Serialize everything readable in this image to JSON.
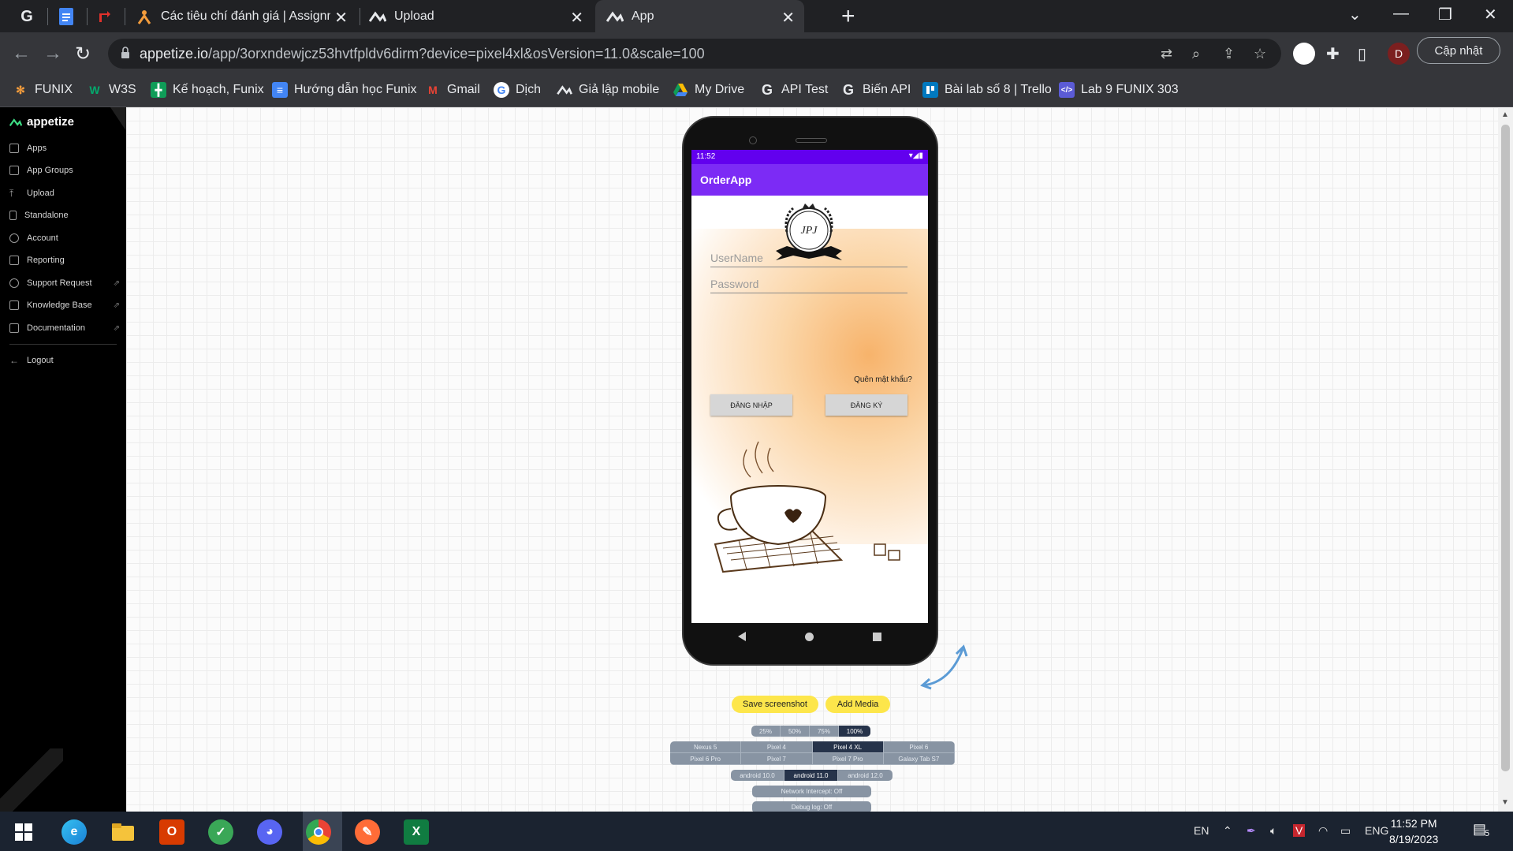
{
  "browser": {
    "tabs": [
      {
        "title": "Các tiêu chí đánh giá | Assignment",
        "active": false
      },
      {
        "title": "Upload",
        "active": false
      },
      {
        "title": "App",
        "active": true
      }
    ],
    "pinned_tabs": [
      "G",
      "docs",
      "red-arrow"
    ],
    "url_host": "appetize.io",
    "url_path": "/app/3orxndewjcz53hvtfpldv6dirm?device=pixel4xl&osVersion=11.0&scale=100",
    "update_label": "Cập nhật",
    "profile_initial": "D"
  },
  "bookmarks": [
    {
      "label": "FUNIX",
      "icon": "funix-icon",
      "color": "#f39c3c"
    },
    {
      "label": "W3S",
      "icon": "w3s-icon",
      "color": "#04aa6d"
    },
    {
      "label": "Kế hoạch, Funix",
      "icon": "sheets-icon",
      "color": "#0f9d58"
    },
    {
      "label": "Hướng dẫn học Funix",
      "icon": "docs-icon",
      "color": "#4285f4"
    },
    {
      "label": "Gmail",
      "icon": "gmail-icon",
      "color": "#ea4335"
    },
    {
      "label": "Dịch",
      "icon": "google-icon",
      "color": "#ffffff"
    },
    {
      "label": "Giả lập mobile",
      "icon": "appetize-icon",
      "color": "#ffffff"
    },
    {
      "label": "My Drive",
      "icon": "drive-icon",
      "color": "#fbbc04"
    },
    {
      "label": "API Test",
      "icon": "g-icon",
      "color": "#ffffff"
    },
    {
      "label": "Biến API",
      "icon": "g-icon",
      "color": "#ffffff"
    },
    {
      "label": "Bài lab số 8 | Trello",
      "icon": "trello-icon",
      "color": "#0079bf"
    },
    {
      "label": "Lab 9 FUNIX 303",
      "icon": "code-icon",
      "color": "#5b5bd6"
    }
  ],
  "sidebar": {
    "brand": "appetize",
    "items": [
      {
        "label": "Apps",
        "external": false
      },
      {
        "label": "App Groups",
        "external": false
      },
      {
        "label": "Upload",
        "external": false
      },
      {
        "label": "Standalone",
        "external": false
      },
      {
        "label": "Account",
        "external": false
      },
      {
        "label": "Reporting",
        "external": false
      },
      {
        "label": "Support Request",
        "external": true
      },
      {
        "label": "Knowledge Base",
        "external": true
      },
      {
        "label": "Documentation",
        "external": true
      }
    ],
    "logout": "Logout"
  },
  "phone": {
    "status_time": "11:52",
    "app_title": "OrderApp",
    "logo_text": "JPJ",
    "username_placeholder": "UserName",
    "password_placeholder": "Password",
    "forgot_label": "Quên mật khẩu?",
    "login_label": "ĐĂNG NHẬP",
    "register_label": "ĐĂNG KÝ"
  },
  "controls": {
    "save_screenshot": "Save screenshot",
    "add_media": "Add Media",
    "scales": [
      "25%",
      "50%",
      "75%",
      "100%"
    ],
    "scale_selected": "100%",
    "devices": [
      "Nexus 5",
      "Pixel 4",
      "Pixel 4 XL",
      "Pixel 6",
      "Pixel 6 Pro",
      "Pixel 7",
      "Pixel 7 Pro",
      "Galaxy Tab S7"
    ],
    "device_selected": "Pixel 4 XL",
    "os_versions": [
      "android 10.0",
      "android 11.0",
      "android 12.0"
    ],
    "os_selected": "android 11.0",
    "network_intercept": "Network Intercept: Off",
    "debug_log": "Debug log: Off"
  },
  "taskbar": {
    "lang": "EN",
    "ime": "ENG",
    "time": "11:52 PM",
    "date": "8/19/2023",
    "notifications": "5"
  }
}
